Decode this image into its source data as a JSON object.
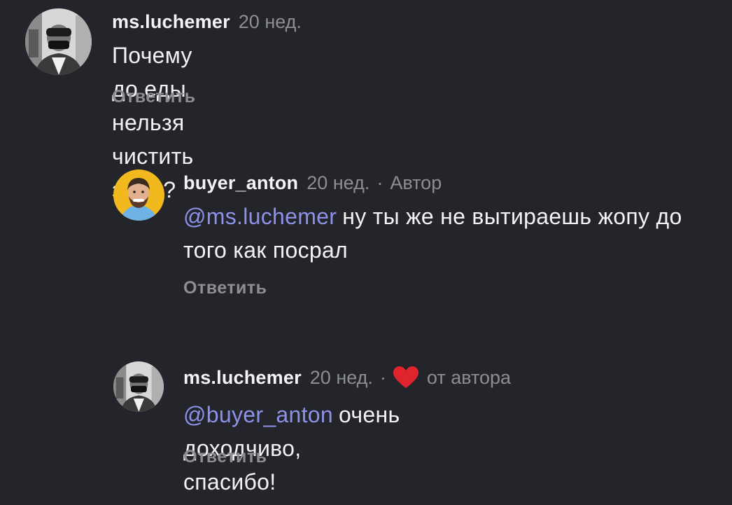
{
  "comments": [
    {
      "username": "ms.luchemer",
      "time": "20 нед.",
      "text": "Почему до еды нельзя чистить зубы?",
      "reply_label": "Ответить"
    },
    {
      "username": "buyer_anton",
      "time": "20 нед.",
      "separator": "·",
      "tag": "Автор",
      "mention": "@ms.luchemer",
      "text": "ну ты же не вытираешь жопу до того как посрал",
      "reply_label": "Ответить"
    },
    {
      "username": "ms.luchemer",
      "time": "20 нед.",
      "separator": "·",
      "liked_tag": "от автора",
      "mention": "@buyer_anton",
      "text": "очень доходчиво, спасибо!",
      "reply_label": "Ответить"
    }
  ],
  "colors": {
    "background": "#23252a",
    "mention": "#8c92e8",
    "muted": "#8c8e94",
    "heart": "#e0242e",
    "author_avatar_bg": "#f2b91e"
  },
  "icons": {
    "liked_by_author": "heart-icon"
  }
}
